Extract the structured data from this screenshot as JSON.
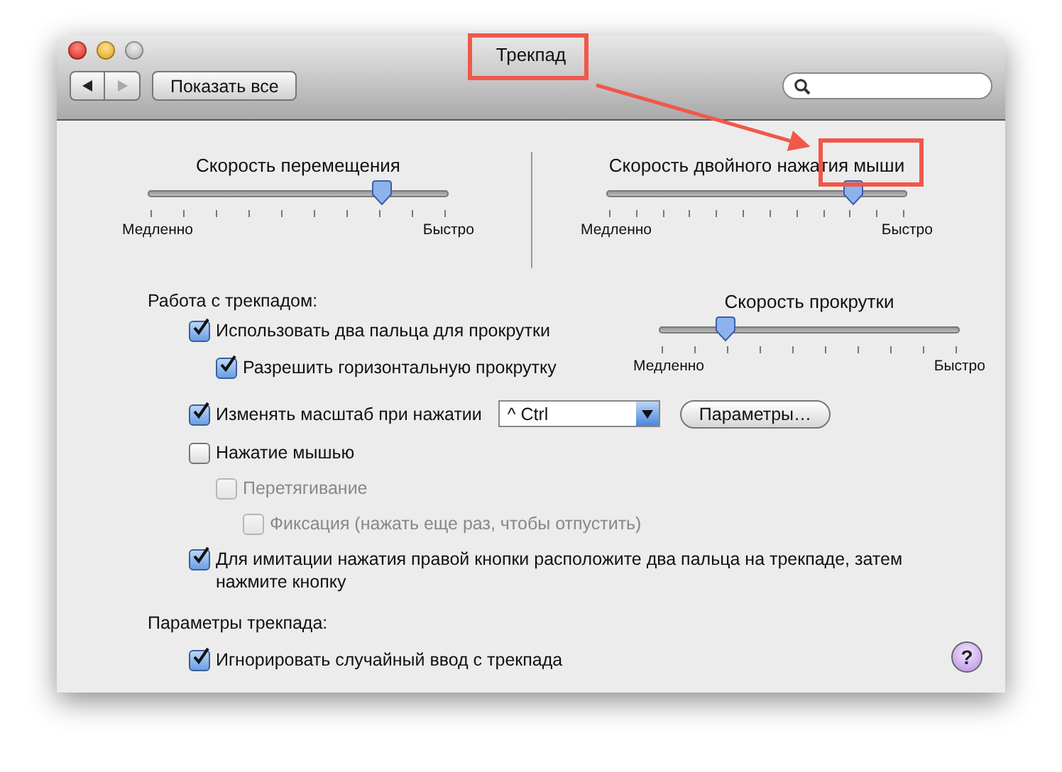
{
  "window": {
    "title": "Трекпад"
  },
  "toolbar": {
    "show_all": "Показать все"
  },
  "top_sliders": [
    {
      "title": "Скорость перемещения",
      "level": 0.78,
      "min_label": "Медленно",
      "max_label": "Быстро"
    },
    {
      "title": "Скорость двойного нажатия мыши",
      "level": 0.82,
      "min_label": "Медленно",
      "max_label": "Быстро"
    }
  ],
  "trackpad_section": {
    "heading": "Работа с трекпадом:",
    "scroll_slider": {
      "title": "Скорость прокрутки",
      "level": 0.22,
      "min_label": "Медленно",
      "max_label": "Быстро"
    },
    "options": [
      {
        "label": "Использовать два пальца для прокрутки",
        "checked": true,
        "disabled": false,
        "children": [
          {
            "label": "Разрешить горизонтальную прокрутку",
            "checked": true,
            "disabled": false
          }
        ]
      },
      {
        "label": "Изменять масштаб при нажатии",
        "checked": true,
        "disabled": false,
        "select": {
          "value": "^ Ctrl"
        },
        "button": "Параметры…"
      },
      {
        "label": "Нажатие мышью",
        "checked": false,
        "disabled": false,
        "children": [
          {
            "label": "Перетягивание",
            "checked": false,
            "disabled": true,
            "children": [
              {
                "label": "Фиксация (нажать еще раз, чтобы отпустить)",
                "checked": false,
                "disabled": true
              }
            ]
          }
        ]
      },
      {
        "label": "Для имитации нажатия правой кнопки расположите два пальца на трекпаде, затем нажмите кнопку",
        "checked": true,
        "disabled": false
      }
    ]
  },
  "params_section": {
    "heading": "Параметры трекпада:",
    "options": [
      {
        "label": "Игнорировать случайный ввод с трекпада",
        "checked": true,
        "disabled": false
      }
    ]
  },
  "help_button": "?"
}
